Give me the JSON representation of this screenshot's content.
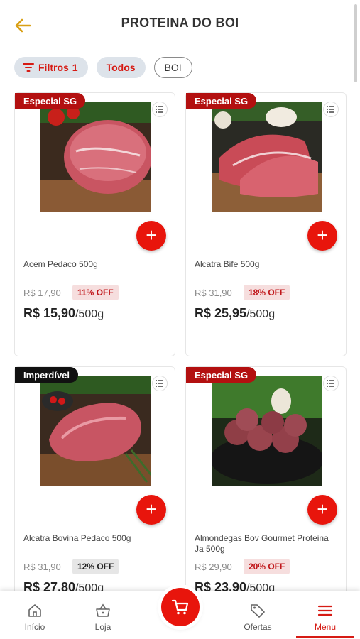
{
  "header": {
    "title": "PROTEINA DO BOI",
    "back_icon": "arrow-left-icon"
  },
  "filters": {
    "filters_label": "Filtros",
    "filters_count": "1",
    "chips": [
      "Todos",
      "BOI"
    ]
  },
  "colors": {
    "brand_red": "#e8150c",
    "badge_red": "#b31010",
    "badge_black": "#111111"
  },
  "products": [
    {
      "badge": "Especial SG",
      "name": "Acem Pedaco 500g",
      "old_price": "R$ 17,90",
      "discount": "11% OFF",
      "price": "R$ 15,90",
      "unit": "/500g"
    },
    {
      "badge": "Especial SG",
      "name": "Alcatra Bife 500g",
      "old_price": "R$ 31,90",
      "discount": "18% OFF",
      "price": "R$ 25,95",
      "unit": "/500g"
    },
    {
      "badge": "Imperdível",
      "name": "Alcatra Bovina Pedaco 500g",
      "old_price": "R$ 31,90",
      "discount": "12% OFF",
      "price": "R$ 27,80",
      "unit": "/500g"
    },
    {
      "badge": "Especial SG",
      "name": "Almondegas Bov Gourmet Proteina Ja 500g",
      "old_price": "R$ 29,90",
      "discount": "20% OFF",
      "price": "R$ 23,90",
      "unit": "/500g"
    }
  ],
  "nav": {
    "items": [
      {
        "label": "Início",
        "icon": "home-icon"
      },
      {
        "label": "Loja",
        "icon": "basket-icon"
      },
      {
        "label": "Ofertas",
        "icon": "tag-icon"
      },
      {
        "label": "Menu",
        "icon": "menu-icon"
      }
    ],
    "cart_icon": "cart-icon",
    "active": "Menu"
  }
}
